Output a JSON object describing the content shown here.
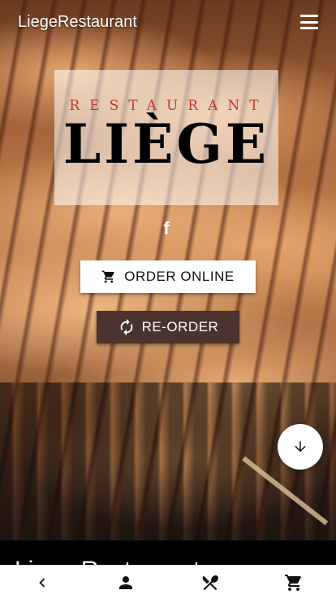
{
  "header": {
    "app_title": "LiegeRestaurant",
    "menu_icon": "hamburger-menu-icon"
  },
  "logo": {
    "subtitle": "RESTAURANT",
    "name": "LIÈGE"
  },
  "social": {
    "facebook_glyph": "f",
    "icon": "facebook-icon"
  },
  "actions": {
    "order_online_label": "ORDER ONLINE",
    "order_online_icon": "shopping-cart-icon",
    "reorder_label": "RE-ORDER",
    "reorder_icon": "refresh-icon"
  },
  "fab": {
    "icon": "arrow-down-icon"
  },
  "section": {
    "heading": "Liege Restaurant"
  },
  "bottom_nav": {
    "items": [
      {
        "icon": "chevron-left-icon"
      },
      {
        "icon": "person-icon"
      },
      {
        "icon": "fork-knife-icon"
      },
      {
        "icon": "shopping-cart-icon"
      }
    ]
  },
  "colors": {
    "reorder_bg": "#4a332e",
    "logo_subtitle": "#c0392b",
    "nav_bg": "#ffffff"
  }
}
